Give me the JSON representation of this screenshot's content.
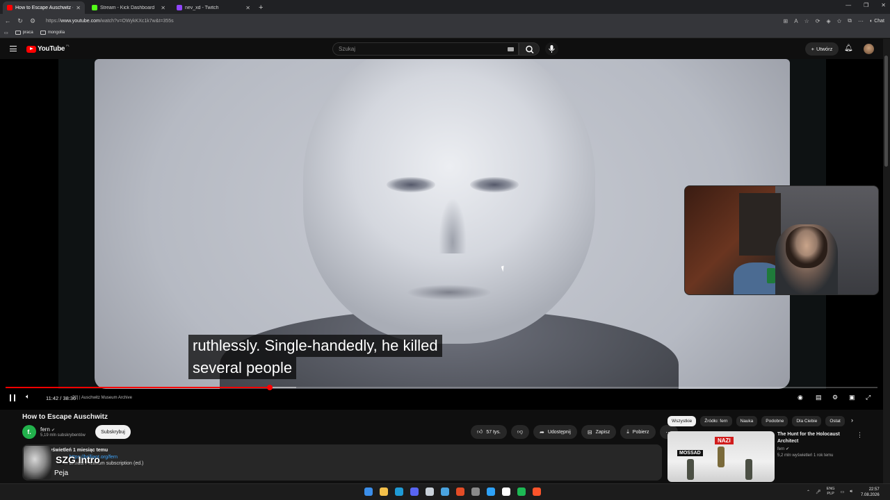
{
  "browser": {
    "tabs": [
      {
        "title": "How to Escape Auschwitz - W",
        "favicon_color": "#ff0000",
        "active": true
      },
      {
        "title": "Stream - Kick Dashboard",
        "favicon_color": "#53fc18",
        "active": false
      },
      {
        "title": "nev_xd - Twitch",
        "favicon_color": "#9146ff",
        "active": false
      }
    ],
    "url_prefix": "https://",
    "url_domain": "www.youtube.com",
    "url_path": "/watch?v=OWykKXc1k7w&t=355s",
    "chat_label": "Chat",
    "bookmarks": [
      "praca",
      "mongolia"
    ]
  },
  "youtube": {
    "logo_text": "YouTube",
    "country_code": "PL",
    "search_placeholder": "Szukaj",
    "create_label": "Utwórz"
  },
  "player": {
    "caption_line1": "ruthlessly. Single-handedly, he killed",
    "caption_line2": "several people",
    "time": "11:42 / 38:36",
    "chapter": "72] | Auschwitz Museum Archive",
    "progress_fraction": 0.303,
    "buffer_fraction": 0.333
  },
  "video": {
    "title": "How to Escape Auschwitz",
    "channel": "fern",
    "channel_initial": "f.",
    "subscribers": "5,19 mln subskrybentów",
    "subscribe_label": "Subskrybuj",
    "likes": "57 tys.",
    "share_label": "Udostępnij",
    "save_label": "Zapisz",
    "download_label": "Pobierz",
    "description_meta": "1,7 mln wyświetleń  1 miesiąc temu",
    "description_line2_prefix": "...",
    "description_link": "https://brilliant.org/fern",
    "description_line3": "... annual Premium subscription (ed.)"
  },
  "now_playing_overlay": {
    "title": "SZG Intro",
    "artist": "Peja"
  },
  "filters": [
    "Wszystkie",
    "Źródło: fern",
    "Nauka",
    "Podobne",
    "Dla Ciebie",
    "Ostat"
  ],
  "recommended": {
    "title": "The Hunt for the Holocaust Architect",
    "channel": "fern",
    "meta": "5,2 mln wyświetleń  1 rok temu",
    "thumb_label_left": "MOSSAD",
    "thumb_label_top": "NAZI"
  },
  "taskbar": {
    "lang_line1": "ENG",
    "lang_line2": "PLP",
    "time": "22:57",
    "date": "7.08.2026",
    "app_colors": [
      "#3b8eea",
      "#f3c04a",
      "#1f9bd6",
      "#5865f2",
      "#c9d1d9",
      "#4aa3df",
      "#e34c26",
      "#8a8a8a",
      "#2ea2f8",
      "#ffffff",
      "#1db954",
      "#fb542b"
    ]
  }
}
